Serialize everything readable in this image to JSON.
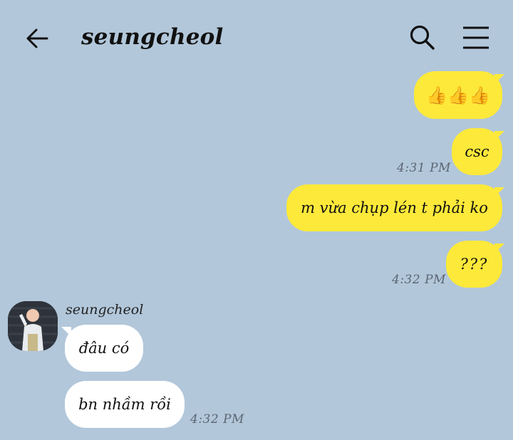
{
  "header": {
    "title": "seungcheol",
    "back_icon": "back-arrow-icon",
    "search_icon": "search-icon",
    "menu_icon": "menu-icon"
  },
  "colors": {
    "background": "#b2c7da",
    "outgoing_bubble": "#fde93a",
    "incoming_bubble": "#ffffff",
    "timestamp": "#5c6673"
  },
  "messages": [
    {
      "direction": "outgoing",
      "text": "👍👍👍",
      "time": ""
    },
    {
      "direction": "outgoing",
      "text": "csc",
      "time": "4:31 PM"
    },
    {
      "direction": "outgoing",
      "text": "m vừa chụp lén t phải ko",
      "time": ""
    },
    {
      "direction": "outgoing",
      "text": "???",
      "time": "4:32 PM"
    },
    {
      "direction": "incoming",
      "sender": "seungcheol",
      "text": "đâu có",
      "time": ""
    },
    {
      "direction": "incoming",
      "text": "bn nhầm rồi",
      "time": "4:32 PM"
    }
  ]
}
